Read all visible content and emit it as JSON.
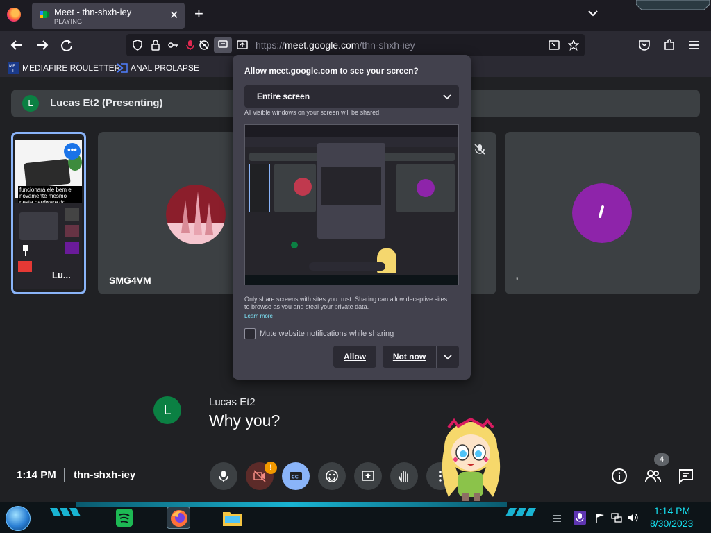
{
  "browser": {
    "tab": {
      "title": "Meet - thn-shxh-iey",
      "status": "PLAYING",
      "close": "✕"
    },
    "new_tab": "+",
    "url": {
      "prefix": "https://",
      "host": "meet.google.com",
      "path": "/thn-shxh-iey"
    },
    "bookmarks": [
      {
        "label": "MEDIAFIRE ROULETTER",
        "icon": "mediafire-icon"
      },
      {
        "label": "ANAL PROLAPSE",
        "icon": "bookmark-folder-icon"
      }
    ]
  },
  "meet": {
    "presenting": {
      "avatar_letter": "L",
      "label": "Lucas Et2 (Presenting)"
    },
    "self_tile": {
      "caption": "funcionará ele bem e novamente mesmo neste hardware do",
      "name": "Lu...",
      "more_label": "•••"
    },
    "tiles": [
      {
        "name": "SMG4VM"
      },
      {
        "name": ""
      },
      {
        "name": "'"
      }
    ],
    "chat": {
      "avatar_letter": "L",
      "name": "Lucas Et2",
      "message": "Why you?"
    },
    "bottom": {
      "time": "1:14 PM",
      "code": "thn-shxh-iey",
      "warn_badge": "!",
      "participant_count": "4",
      "controls": [
        "mic-icon",
        "camera-off-icon",
        "captions-icon",
        "emoji-icon",
        "present-icon",
        "raise-hand-icon",
        "more-options-icon"
      ]
    }
  },
  "popup": {
    "title": "Allow meet.google.com to see your screen?",
    "select_value": "Entire screen",
    "note": "All visible windows on your screen will be shared.",
    "warning": "Only share screens with sites you trust. Sharing can allow deceptive sites to browse as you and steal your private data.",
    "learn_more": "Learn more",
    "checkbox_label": "Mute website notifications while sharing",
    "allow": "Allow",
    "not_now": "Not now"
  },
  "taskbar": {
    "clock_time": "1:14 PM",
    "clock_date": "8/30/2023",
    "apps": [
      "spotify-icon",
      "firefox-icon",
      "file-explorer-icon"
    ]
  },
  "colors": {
    "meet_bg": "#202124",
    "tile_bg": "#3c4043",
    "accent_blue": "#8ab4f8",
    "avatar_green": "#0b8043",
    "clock_cyan": "#16e0f0",
    "popup_bg": "#42414d"
  }
}
